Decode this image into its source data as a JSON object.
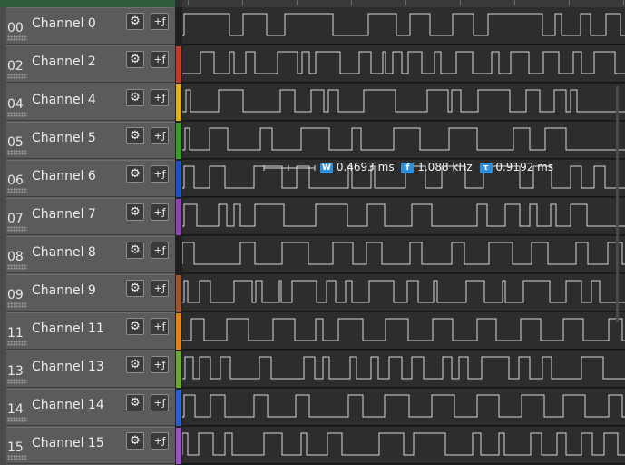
{
  "channels": [
    {
      "num": "00",
      "name": "Channel 0",
      "color": "#1e1e1e",
      "edges": [
        2,
        52,
        67,
        93,
        113,
        166,
        205,
        236,
        251,
        273,
        298,
        321,
        337,
        397,
        411,
        418,
        439,
        450,
        467,
        483
      ]
    },
    {
      "num": "02",
      "name": "Channel 2",
      "color": "#c0392b",
      "edges": [
        20,
        35,
        52,
        57,
        70,
        80,
        105,
        127,
        132,
        140,
        147,
        174,
        195,
        208,
        221,
        224,
        232,
        242,
        249,
        264,
        278,
        285,
        302,
        320,
        341,
        349,
        362,
        382,
        398,
        415,
        431,
        440,
        454,
        477
      ]
    },
    {
      "num": "04",
      "name": "Channel 4",
      "color": "#e0b020",
      "edges": [
        4,
        9,
        40,
        67,
        108,
        124,
        142,
        156,
        161,
        172,
        200,
        235,
        270,
        293,
        297,
        307,
        326,
        361,
        379,
        394,
        410,
        423,
        428,
        435
      ]
    },
    {
      "num": "05",
      "name": "Channel 5",
      "color": "#3b9c2b",
      "edges": [
        3,
        8,
        30,
        50,
        86,
        99,
        131,
        162,
        187,
        197,
        233,
        262,
        294,
        325,
        365,
        383,
        400,
        423
      ]
    },
    {
      "num": "06",
      "name": "Channel 6",
      "color": "#2050c0",
      "edges": [
        2,
        13,
        30,
        47,
        79,
        110,
        126,
        140,
        183,
        187,
        208,
        212,
        246,
        268,
        286,
        312,
        332,
        372,
        387,
        407,
        428,
        440,
        454,
        466
      ]
    },
    {
      "num": "07",
      "name": "Channel 7",
      "color": "#8e44ad",
      "edges": [
        2,
        16,
        40,
        49,
        57,
        64,
        80,
        112,
        147,
        182,
        204,
        223,
        253,
        275,
        325,
        336,
        356,
        372,
        383,
        391,
        406,
        412,
        428,
        446
      ]
    },
    {
      "num": "08",
      "name": "Channel 8",
      "color": "#1e1e1e",
      "edges": [
        0,
        13,
        64,
        80,
        110,
        139,
        166,
        188,
        203,
        220,
        251,
        264,
        297,
        311,
        338,
        364,
        385,
        403,
        434,
        447,
        469,
        485
      ]
    },
    {
      "num": "09",
      "name": "Channel 9",
      "color": "#a0522d",
      "edges": [
        2,
        6,
        19,
        31,
        57,
        77,
        81,
        88,
        107,
        109,
        121,
        148,
        159,
        169,
        180,
        187,
        206,
        233,
        248,
        260,
        277,
        281,
        313,
        333,
        353,
        356,
        376,
        405,
        423,
        440,
        451,
        460
      ]
    },
    {
      "num": "11",
      "name": "Channel 11",
      "color": "#e0831e",
      "edges": [
        10,
        24,
        49,
        73,
        100,
        124,
        147,
        155,
        172,
        199,
        224,
        249,
        276,
        298,
        325,
        346,
        373,
        395,
        420,
        442,
        470,
        485
      ]
    },
    {
      "num": "13",
      "name": "Channel 13",
      "color": "#6aa832",
      "edges": [
        3,
        12,
        19,
        31,
        42,
        53,
        85,
        98,
        134,
        146,
        155,
        162,
        185,
        192,
        208,
        216,
        228,
        242,
        253,
        266,
        287,
        297,
        305,
        315,
        330,
        360,
        371,
        383,
        397,
        407,
        440,
        464
      ]
    },
    {
      "num": "14",
      "name": "Channel 14",
      "color": "#2a5fd0",
      "edges": [
        2,
        14,
        31,
        47,
        79,
        94,
        125,
        140,
        183,
        199,
        223,
        250,
        275,
        300,
        325,
        349,
        374,
        399,
        420,
        444,
        470,
        485
      ]
    },
    {
      "num": "15",
      "name": "Channel 15",
      "color": "#9b4fc4",
      "edges": [
        0,
        6,
        18,
        34,
        47,
        55,
        90,
        110,
        131,
        137,
        160,
        176,
        217,
        244,
        255,
        290,
        320,
        329,
        349,
        355,
        384,
        396,
        413,
        423,
        440,
        452,
        465,
        480
      ]
    }
  ],
  "measurement": {
    "width": "0.4693 ms",
    "frequency": "1.088 kHz",
    "period": "0.9192 ms",
    "w_icon": "W",
    "f_icon": "f",
    "t_icon": "τ"
  },
  "buttons": {
    "gear": "⚙",
    "trigger": "+ƒ"
  }
}
